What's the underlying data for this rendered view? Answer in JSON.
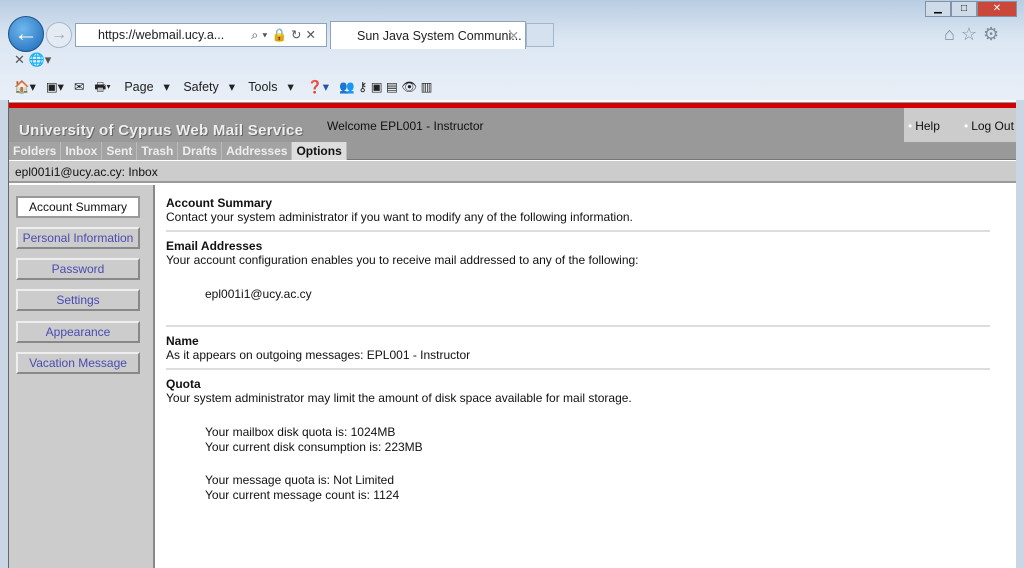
{
  "browser": {
    "url": "https://webmail.ucy.a...",
    "tab_title": "Sun Java System Communi...",
    "commands": [
      "Page",
      "Safety",
      "Tools"
    ]
  },
  "header": {
    "brand": "University of Cyprus Web Mail Service",
    "welcome": "Welcome EPL001 - Instructor",
    "help": "Help",
    "logout": "Log Out"
  },
  "nav": {
    "tabs": [
      "Folders",
      "Inbox",
      "Sent",
      "Trash",
      "Drafts",
      "Addresses",
      "Options"
    ]
  },
  "breadcrumb": "epl001i1@ucy.ac.cy: Inbox",
  "sidebar": {
    "items": [
      "Account Summary",
      "Personal Information",
      "Password",
      "Settings",
      "Appearance",
      "Vacation Message"
    ]
  },
  "main": {
    "account": {
      "title": "Account Summary",
      "text": "Contact your system administrator if you want to modify any of the following information."
    },
    "email": {
      "title": "Email Addresses",
      "text": "Your account configuration enables you to receive mail addressed to any of the following:",
      "address": "epl001i1@ucy.ac.cy"
    },
    "name": {
      "title": "Name",
      "text": "As it appears on outgoing messages: EPL001 - Instructor"
    },
    "quota": {
      "title": "Quota",
      "text": "Your system administrator may limit the amount of disk space available for mail storage.",
      "disk_quota": "Your mailbox disk quota is: 1024MB",
      "disk_usage": "Your current disk consumption is: 223MB",
      "msg_quota": "Your message quota is: Not Limited",
      "msg_count": "Your current message count is: 1124"
    }
  }
}
